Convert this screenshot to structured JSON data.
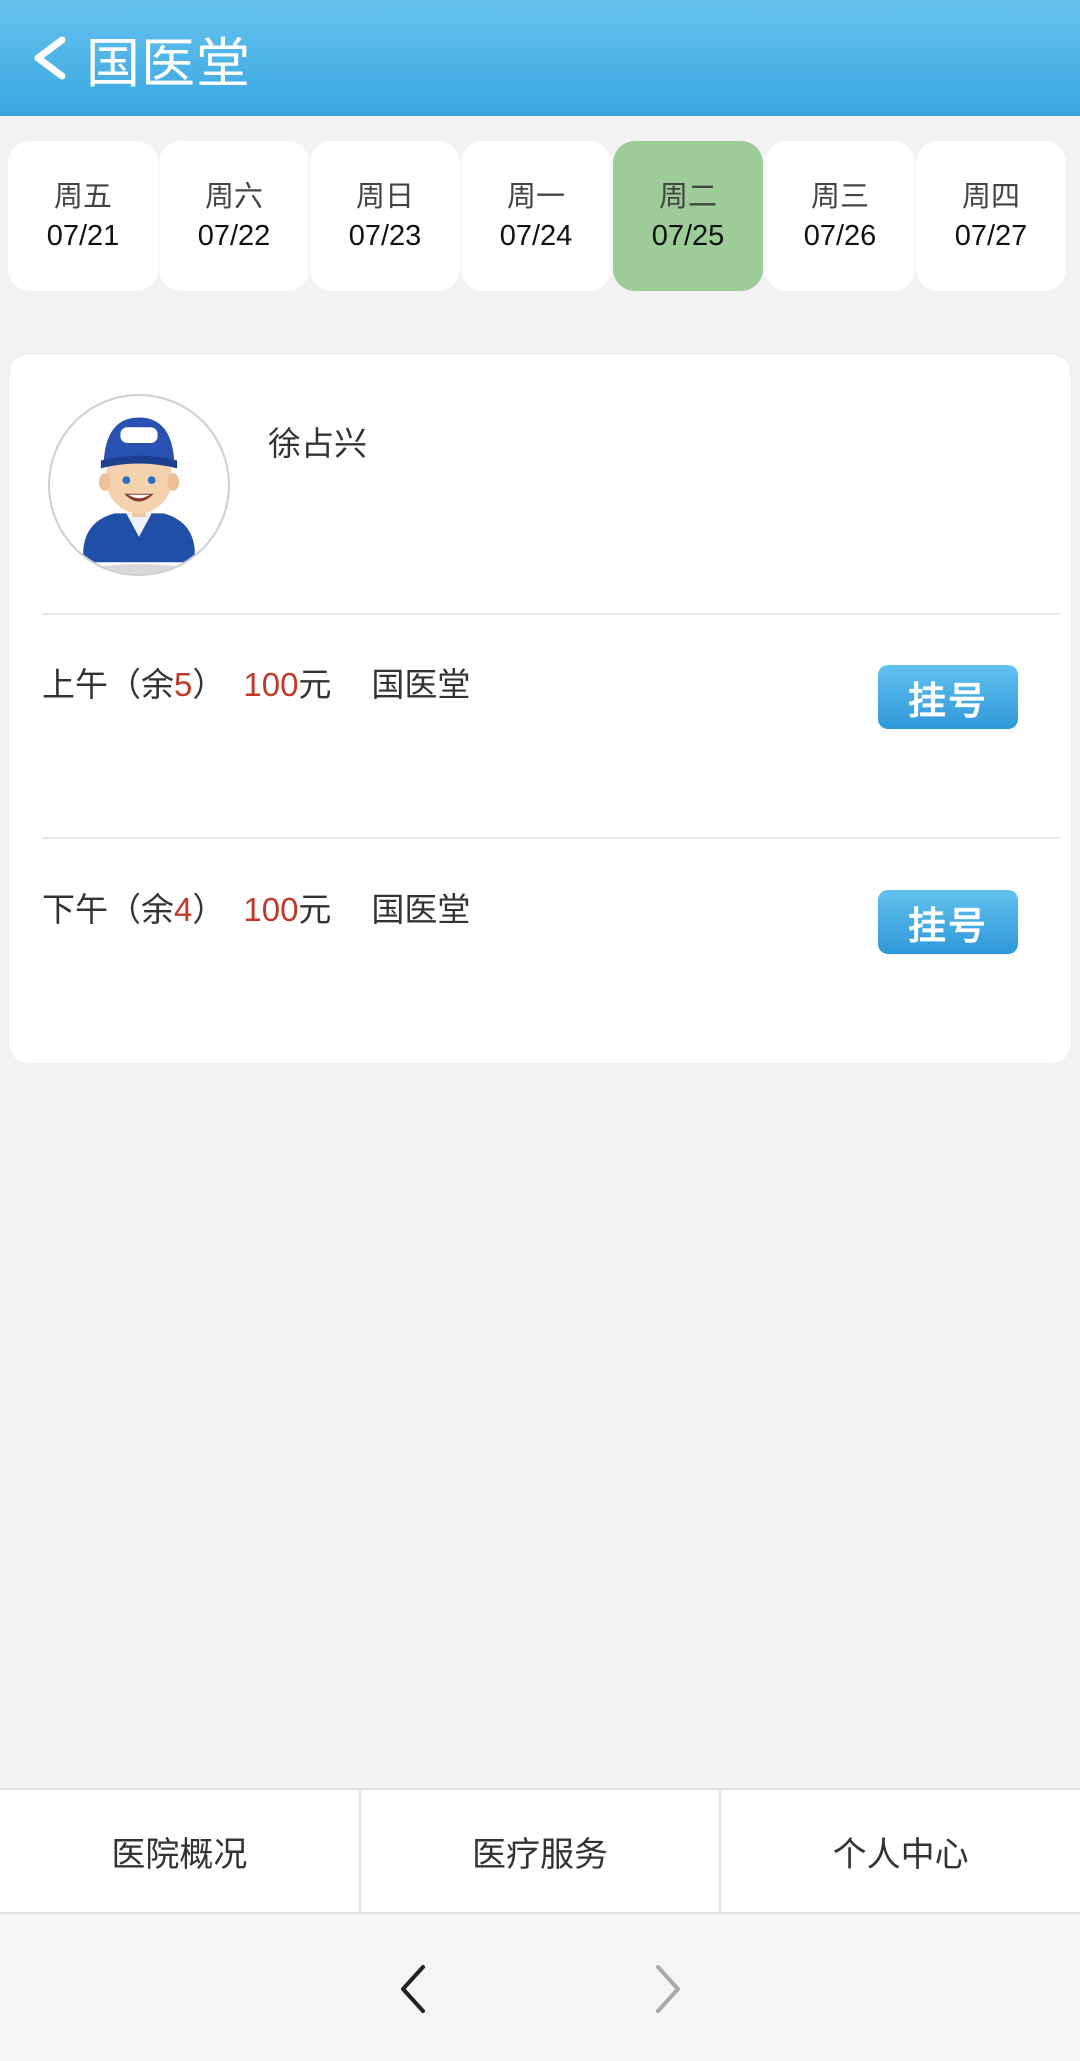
{
  "header": {
    "title": "国医堂",
    "back_icon": "chevron-left-icon"
  },
  "dates": [
    {
      "weekday": "周五",
      "date": "07/21",
      "active": false
    },
    {
      "weekday": "周六",
      "date": "07/22",
      "active": false
    },
    {
      "weekday": "周日",
      "date": "07/23",
      "active": false
    },
    {
      "weekday": "周一",
      "date": "07/24",
      "active": false
    },
    {
      "weekday": "周二",
      "date": "07/25",
      "active": true
    },
    {
      "weekday": "周三",
      "date": "07/26",
      "active": false
    },
    {
      "weekday": "周四",
      "date": "07/27",
      "active": false
    }
  ],
  "doctor": {
    "name": "徐占兴",
    "avatar_icon": "doctor-avatar-icon"
  },
  "slots": [
    {
      "period": "上午",
      "remain_prefix": "（余",
      "remain": "5",
      "remain_suffix": "）",
      "fee": "100",
      "fee_unit": "元",
      "dept": "国医堂",
      "button": "挂号"
    },
    {
      "period": "下午",
      "remain_prefix": "（余",
      "remain": "4",
      "remain_suffix": "）",
      "fee": "100",
      "fee_unit": "元",
      "dept": "国医堂",
      "button": "挂号"
    }
  ],
  "bottom_nav": [
    {
      "label": "医院概况"
    },
    {
      "label": "医疗服务"
    },
    {
      "label": "个人中心"
    }
  ],
  "colors": {
    "header": "#39a6e0",
    "active_tab": "#9dcc99",
    "highlight": "#c0392b",
    "button": "#2f98d8"
  }
}
